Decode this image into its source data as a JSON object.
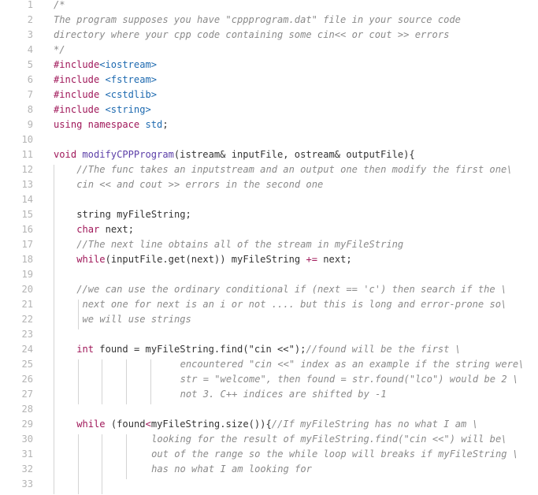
{
  "editor": {
    "language": "cpp",
    "lines": [
      {
        "n": "1",
        "indent": 0,
        "tokens": [
          {
            "t": "/*",
            "c": "cm"
          }
        ]
      },
      {
        "n": "2",
        "indent": 0,
        "tokens": [
          {
            "t": "The program supposes you have \"cppprogram.dat\" file in your source code",
            "c": "cm"
          }
        ]
      },
      {
        "n": "3",
        "indent": 0,
        "tokens": [
          {
            "t": "directory where your cpp code containing some cin<< or cout >> errors",
            "c": "cm"
          }
        ]
      },
      {
        "n": "4",
        "indent": 0,
        "tokens": [
          {
            "t": "*/",
            "c": "cm"
          }
        ]
      },
      {
        "n": "5",
        "indent": 0,
        "tokens": [
          {
            "t": "#include",
            "c": "pp"
          },
          {
            "t": "<iostream>",
            "c": "tp"
          }
        ]
      },
      {
        "n": "6",
        "indent": 0,
        "tokens": [
          {
            "t": "#include",
            "c": "pp"
          },
          {
            "t": " <fstream>",
            "c": "tp"
          }
        ]
      },
      {
        "n": "7",
        "indent": 0,
        "tokens": [
          {
            "t": "#include",
            "c": "pp"
          },
          {
            "t": " <cstdlib>",
            "c": "tp"
          }
        ]
      },
      {
        "n": "8",
        "indent": 0,
        "tokens": [
          {
            "t": "#include",
            "c": "pp"
          },
          {
            "t": " <string>",
            "c": "tp"
          }
        ]
      },
      {
        "n": "9",
        "indent": 0,
        "tokens": [
          {
            "t": "using namespace",
            "c": "kw"
          },
          {
            "t": " ",
            "c": ""
          },
          {
            "t": "std",
            "c": "tp"
          },
          {
            "t": ";",
            "c": ""
          }
        ]
      },
      {
        "n": "10",
        "indent": 0,
        "tokens": []
      },
      {
        "n": "11",
        "indent": 0,
        "tokens": [
          {
            "t": "void",
            "c": "kw"
          },
          {
            "t": " ",
            "c": ""
          },
          {
            "t": "modifyCPPProgram",
            "c": "fn"
          },
          {
            "t": "(istream& inputFile, ostream& outputFile){",
            "c": ""
          }
        ]
      },
      {
        "n": "12",
        "indent": 4,
        "tokens": [
          {
            "t": "//The func takes an inputstream and an output one then modify the first one\\",
            "c": "cm"
          }
        ]
      },
      {
        "n": "13",
        "indent": 4,
        "tokens": [
          {
            "t": "cin << and cout >> errors in the second one",
            "c": "cm"
          }
        ]
      },
      {
        "n": "14",
        "indent": 0,
        "tokens": []
      },
      {
        "n": "15",
        "indent": 4,
        "tokens": [
          {
            "t": "string myFileString;",
            "c": ""
          }
        ]
      },
      {
        "n": "16",
        "indent": 4,
        "tokens": [
          {
            "t": "char",
            "c": "kw"
          },
          {
            "t": " next;",
            "c": ""
          }
        ]
      },
      {
        "n": "17",
        "indent": 4,
        "tokens": [
          {
            "t": "//The next line obtains all of the stream in myFileString",
            "c": "cm"
          }
        ]
      },
      {
        "n": "18",
        "indent": 4,
        "tokens": [
          {
            "t": "while",
            "c": "kw"
          },
          {
            "t": "(inputFile.get(next)) myFileString ",
            "c": ""
          },
          {
            "t": "+=",
            "c": "kw"
          },
          {
            "t": " next;",
            "c": ""
          }
        ]
      },
      {
        "n": "19",
        "indent": 0,
        "tokens": []
      },
      {
        "n": "20",
        "indent": 4,
        "tokens": [
          {
            "t": "//we can use the ordinary conditional if (next == 'c') then search if the \\",
            "c": "cm"
          }
        ]
      },
      {
        "n": "21",
        "indent": 5,
        "tokens": [
          {
            "t": "next one for next is an i or not .... but this is long and error-prone so\\",
            "c": "cm"
          }
        ]
      },
      {
        "n": "22",
        "indent": 5,
        "tokens": [
          {
            "t": "we will use strings",
            "c": "cm"
          }
        ]
      },
      {
        "n": "23",
        "indent": 0,
        "tokens": []
      },
      {
        "n": "24",
        "indent": 4,
        "tokens": [
          {
            "t": "int",
            "c": "kw"
          },
          {
            "t": " found = myFileString.find(\"cin <<\");",
            "c": ""
          },
          {
            "t": "//found will be the first \\",
            "c": "cm"
          }
        ]
      },
      {
        "n": "25",
        "indent": 22,
        "tokens": [
          {
            "t": "encountered \"cin <<\" index as an example if the string were\\",
            "c": "cm"
          }
        ]
      },
      {
        "n": "26",
        "indent": 22,
        "tokens": [
          {
            "t": "str = \"welcome\", then found = str.found(\"lco\") would be 2 \\",
            "c": "cm"
          }
        ]
      },
      {
        "n": "27",
        "indent": 22,
        "tokens": [
          {
            "t": "not 3. C++ indices are shifted by -1",
            "c": "cm"
          }
        ]
      },
      {
        "n": "28",
        "indent": 0,
        "tokens": []
      },
      {
        "n": "29",
        "indent": 4,
        "tokens": [
          {
            "t": "while",
            "c": "kw"
          },
          {
            "t": " (found",
            "c": ""
          },
          {
            "t": "<",
            "c": "kw"
          },
          {
            "t": "myFileString.size()){",
            "c": ""
          },
          {
            "t": "//If myFileString has no what I am \\",
            "c": "cm"
          }
        ]
      },
      {
        "n": "30",
        "indent": 17,
        "tokens": [
          {
            "t": "looking for the result of myFileString.find(\"cin <<\") will be\\",
            "c": "cm"
          }
        ]
      },
      {
        "n": "31",
        "indent": 17,
        "tokens": [
          {
            "t": "out of the range so the while loop will breaks if myFileString \\",
            "c": "cm"
          }
        ]
      },
      {
        "n": "32",
        "indent": 17,
        "tokens": [
          {
            "t": "has no what I am looking for",
            "c": "cm"
          }
        ]
      },
      {
        "n": "33",
        "indent": 0,
        "tokens": []
      }
    ]
  }
}
